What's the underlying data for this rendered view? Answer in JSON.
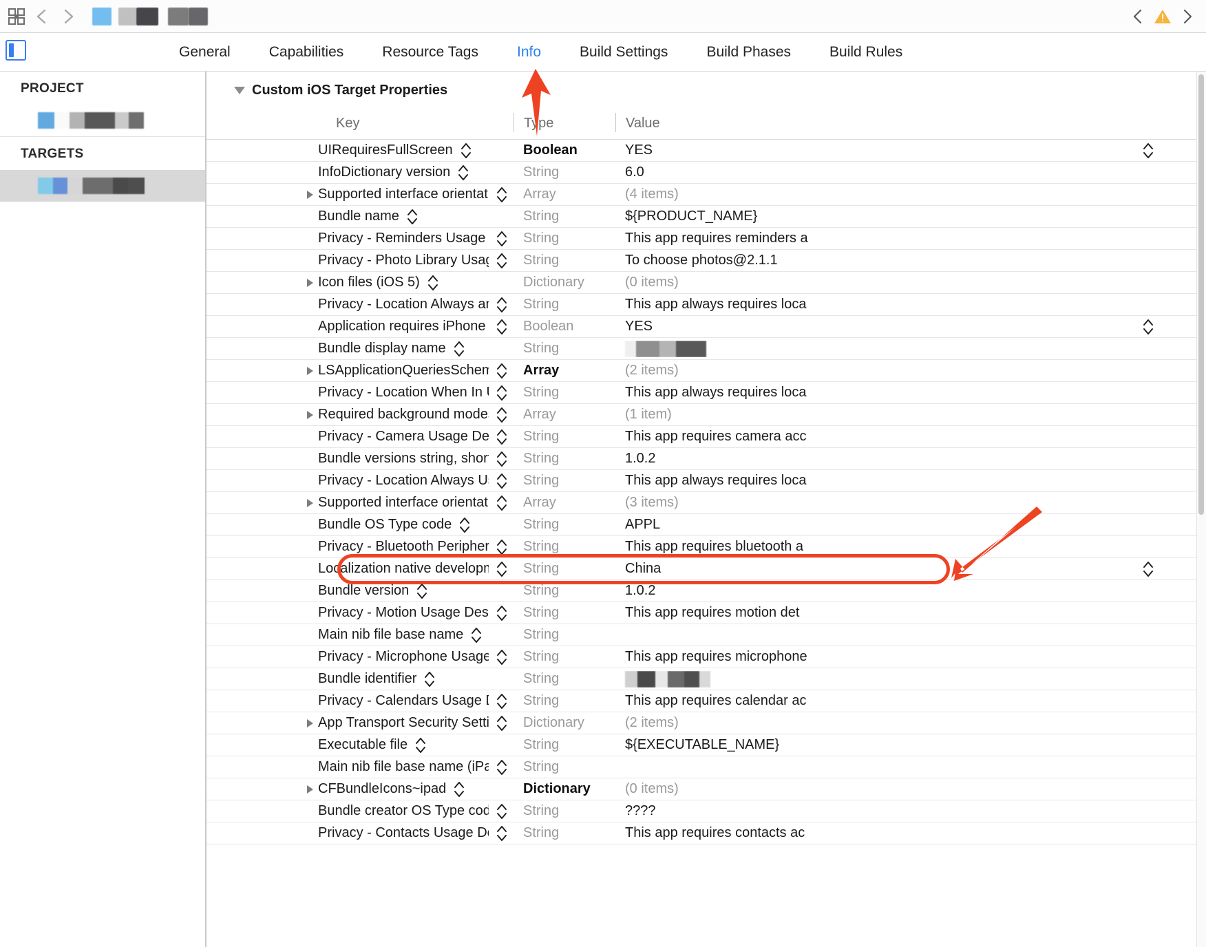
{
  "toolbar": {
    "grid_icon": "grid-icon",
    "back_icon": "chevron-left-icon",
    "forward_icon": "chevron-right-icon",
    "breadcrumb_redacted": true,
    "issue_prev_icon": "chevron-left-icon",
    "issue_warning_icon": "warning-triangle-icon",
    "issue_next_icon": "chevron-right-icon",
    "warning_color": "#f5b43c"
  },
  "tabs": [
    {
      "label": "General",
      "active": false
    },
    {
      "label": "Capabilities",
      "active": false
    },
    {
      "label": "Resource Tags",
      "active": false
    },
    {
      "label": "Info",
      "active": true
    },
    {
      "label": "Build Settings",
      "active": false
    },
    {
      "label": "Build Phases",
      "active": false
    },
    {
      "label": "Build Rules",
      "active": false
    }
  ],
  "tab_active_color": "#2a7ff0",
  "sidebar": {
    "sections": [
      {
        "header": "PROJECT",
        "item_redacted": true,
        "selected": false
      },
      {
        "header": "TARGETS",
        "item_redacted": true,
        "selected": true
      }
    ],
    "selected_bg": "#d8d8d8"
  },
  "main": {
    "section_title": "Custom iOS Target Properties",
    "columns": {
      "key": "Key",
      "type": "Type",
      "value": "Value"
    },
    "rows": [
      {
        "key": "UIRequiresFullScreen",
        "type": "Boolean",
        "type_bold": true,
        "value": "YES",
        "expandable": false,
        "value_stepper": true
      },
      {
        "key": "InfoDictionary version",
        "type": "String",
        "type_bold": false,
        "value": "6.0",
        "expandable": false,
        "value_stepper": false
      },
      {
        "key": "Supported interface orientations (iPad)",
        "type": "Array",
        "type_bold": false,
        "value": "(4 items)",
        "value_muted": true,
        "expandable": true,
        "value_stepper": false
      },
      {
        "key": "Bundle name",
        "type": "String",
        "type_bold": false,
        "value": "${PRODUCT_NAME}",
        "expandable": false,
        "value_stepper": false
      },
      {
        "key": "Privacy - Reminders Usage Description",
        "type": "String",
        "type_bold": false,
        "value": "This app requires reminders a",
        "expandable": false,
        "value_stepper": false
      },
      {
        "key": "Privacy - Photo Library Usage Descri…",
        "type": "String",
        "type_bold": false,
        "value": "To choose photos@2.1.1",
        "expandable": false,
        "value_stepper": false
      },
      {
        "key": "Icon files (iOS 5)",
        "type": "Dictionary",
        "type_bold": false,
        "value": "(0 items)",
        "value_muted": true,
        "expandable": true,
        "value_stepper": false
      },
      {
        "key": "Privacy - Location Always and When I…",
        "type": "String",
        "type_bold": false,
        "value": "This app always requires loca",
        "expandable": false,
        "value_stepper": false
      },
      {
        "key": "Application requires iPhone environm…",
        "type": "Boolean",
        "type_bold": false,
        "value": "YES",
        "expandable": false,
        "value_stepper": true
      },
      {
        "key": "Bundle display name",
        "type": "String",
        "type_bold": false,
        "value": "",
        "value_redacted": true,
        "expandable": false,
        "value_stepper": false
      },
      {
        "key": "LSApplicationQueriesSchemes",
        "type": "Array",
        "type_bold": true,
        "value": "(2 items)",
        "value_muted": true,
        "expandable": true,
        "value_stepper": false
      },
      {
        "key": "Privacy - Location When In Use Usag…",
        "type": "String",
        "type_bold": false,
        "value": "This app always requires loca",
        "expandable": false,
        "value_stepper": false
      },
      {
        "key": "Required background modes",
        "type": "Array",
        "type_bold": false,
        "value": "(1 item)",
        "value_muted": true,
        "expandable": true,
        "value_stepper": false
      },
      {
        "key": "Privacy - Camera Usage Description",
        "type": "String",
        "type_bold": false,
        "value": "This app requires camera acc",
        "expandable": false,
        "value_stepper": false
      },
      {
        "key": "Bundle versions string, short",
        "type": "String",
        "type_bold": false,
        "value": "1.0.2",
        "expandable": false,
        "value_stepper": false
      },
      {
        "key": "Privacy - Location Always Usage Des…",
        "type": "String",
        "type_bold": false,
        "value": "This app always requires loca",
        "expandable": false,
        "value_stepper": false
      },
      {
        "key": "Supported interface orientations",
        "type": "Array",
        "type_bold": false,
        "value": "(3 items)",
        "value_muted": true,
        "expandable": true,
        "value_stepper": false
      },
      {
        "key": "Bundle OS Type code",
        "type": "String",
        "type_bold": false,
        "value": "APPL",
        "expandable": false,
        "value_stepper": false
      },
      {
        "key": "Privacy - Bluetooth Peripheral Usage…",
        "type": "String",
        "type_bold": false,
        "value": "This app requires bluetooth a",
        "expandable": false,
        "value_stepper": false
      },
      {
        "key": "Localization native development region",
        "type": "String",
        "type_bold": false,
        "value": "China",
        "expandable": false,
        "value_stepper": true,
        "highlighted": true
      },
      {
        "key": "Bundle version",
        "type": "String",
        "type_bold": false,
        "value": "1.0.2",
        "expandable": false,
        "value_stepper": false
      },
      {
        "key": "Privacy - Motion Usage Description",
        "type": "String",
        "type_bold": false,
        "value": "This app requires motion det",
        "expandable": false,
        "value_stepper": false
      },
      {
        "key": "Main nib file base name",
        "type": "String",
        "type_bold": false,
        "value": "",
        "expandable": false,
        "value_stepper": false
      },
      {
        "key": "Privacy - Microphone Usage Descript…",
        "type": "String",
        "type_bold": false,
        "value": "This app requires microphone",
        "expandable": false,
        "value_stepper": false
      },
      {
        "key": "Bundle identifier",
        "type": "String",
        "type_bold": false,
        "value": "",
        "value_redacted": true,
        "expandable": false,
        "value_stepper": false
      },
      {
        "key": "Privacy - Calendars Usage Description",
        "type": "String",
        "type_bold": false,
        "value": "This app requires calendar ac",
        "expandable": false,
        "value_stepper": false
      },
      {
        "key": "App Transport Security Settings",
        "type": "Dictionary",
        "type_bold": false,
        "value": "(2 items)",
        "value_muted": true,
        "expandable": true,
        "value_stepper": false
      },
      {
        "key": "Executable file",
        "type": "String",
        "type_bold": false,
        "value": "${EXECUTABLE_NAME}",
        "expandable": false,
        "value_stepper": false
      },
      {
        "key": "Main nib file base name (iPad)",
        "type": "String",
        "type_bold": false,
        "value": "",
        "expandable": false,
        "value_stepper": false
      },
      {
        "key": "CFBundleIcons~ipad",
        "type": "Dictionary",
        "type_bold": true,
        "value": "(0 items)",
        "value_muted": true,
        "expandable": true,
        "value_stepper": false
      },
      {
        "key": "Bundle creator OS Type code",
        "type": "String",
        "type_bold": false,
        "value": "????",
        "expandable": false,
        "value_stepper": false
      },
      {
        "key": "Privacy - Contacts Usage Description",
        "type": "String",
        "type_bold": false,
        "value": "This app requires contacts ac",
        "expandable": false,
        "value_stepper": false
      }
    ]
  },
  "annotations": {
    "color": "#ee4323",
    "arrow_up_target": "Info",
    "arrow_down_left_target": "Localization native development region",
    "highlight_row": "Localization native development region"
  }
}
